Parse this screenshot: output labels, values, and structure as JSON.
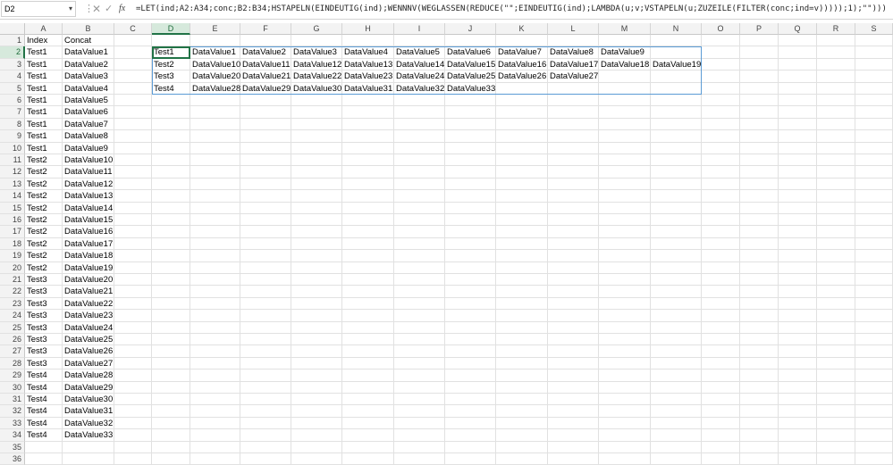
{
  "formula_bar": {
    "name_box": "D2",
    "fx_label": "fx",
    "formula": "=LET(ind;A2:A34;conc;B2:B34;HSTAPELN(EINDEUTIG(ind);WENNNV(WEGLASSEN(REDUCE(\"\";EINDEUTIG(ind);LAMBDA(u;v;VSTAPELN(u;ZUZEILE(FILTER(conc;ind=v)))));1);\"\")))"
  },
  "columns": [
    "A",
    "B",
    "C",
    "D",
    "E",
    "F",
    "G",
    "H",
    "I",
    "J",
    "K",
    "L",
    "M",
    "N",
    "O",
    "P",
    "Q",
    "R",
    "S"
  ],
  "selected_column": "D",
  "selected_row": 2,
  "row_count": 36,
  "headers": {
    "A": "Index",
    "B": "Concat"
  },
  "source_rows": [
    [
      "Test1",
      "DataValue1"
    ],
    [
      "Test1",
      "DataValue2"
    ],
    [
      "Test1",
      "DataValue3"
    ],
    [
      "Test1",
      "DataValue4"
    ],
    [
      "Test1",
      "DataValue5"
    ],
    [
      "Test1",
      "DataValue6"
    ],
    [
      "Test1",
      "DataValue7"
    ],
    [
      "Test1",
      "DataValue8"
    ],
    [
      "Test1",
      "DataValue9"
    ],
    [
      "Test2",
      "DataValue10"
    ],
    [
      "Test2",
      "DataValue11"
    ],
    [
      "Test2",
      "DataValue12"
    ],
    [
      "Test2",
      "DataValue13"
    ],
    [
      "Test2",
      "DataValue14"
    ],
    [
      "Test2",
      "DataValue15"
    ],
    [
      "Test2",
      "DataValue16"
    ],
    [
      "Test2",
      "DataValue17"
    ],
    [
      "Test2",
      "DataValue18"
    ],
    [
      "Test2",
      "DataValue19"
    ],
    [
      "Test3",
      "DataValue20"
    ],
    [
      "Test3",
      "DataValue21"
    ],
    [
      "Test3",
      "DataValue22"
    ],
    [
      "Test3",
      "DataValue23"
    ],
    [
      "Test3",
      "DataValue24"
    ],
    [
      "Test3",
      "DataValue25"
    ],
    [
      "Test3",
      "DataValue26"
    ],
    [
      "Test3",
      "DataValue27"
    ],
    [
      "Test4",
      "DataValue28"
    ],
    [
      "Test4",
      "DataValue29"
    ],
    [
      "Test4",
      "DataValue30"
    ],
    [
      "Test4",
      "DataValue31"
    ],
    [
      "Test4",
      "DataValue32"
    ],
    [
      "Test4",
      "DataValue33"
    ]
  ],
  "spill_result": [
    [
      "Test1",
      "DataValue1",
      "DataValue2",
      "DataValue3",
      "DataValue4",
      "DataValue5",
      "DataValue6",
      "DataValue7",
      "DataValue8",
      "DataValue9",
      ""
    ],
    [
      "Test2",
      "DataValue10",
      "DataValue11",
      "DataValue12",
      "DataValue13",
      "DataValue14",
      "DataValue15",
      "DataValue16",
      "DataValue17",
      "DataValue18",
      "DataValue19"
    ],
    [
      "Test3",
      "DataValue20",
      "DataValue21",
      "DataValue22",
      "DataValue23",
      "DataValue24",
      "DataValue25",
      "DataValue26",
      "DataValue27",
      "",
      ""
    ],
    [
      "Test4",
      "DataValue28",
      "DataValue29",
      "DataValue30",
      "DataValue31",
      "DataValue32",
      "DataValue33",
      "",
      "",
      "",
      ""
    ]
  ]
}
